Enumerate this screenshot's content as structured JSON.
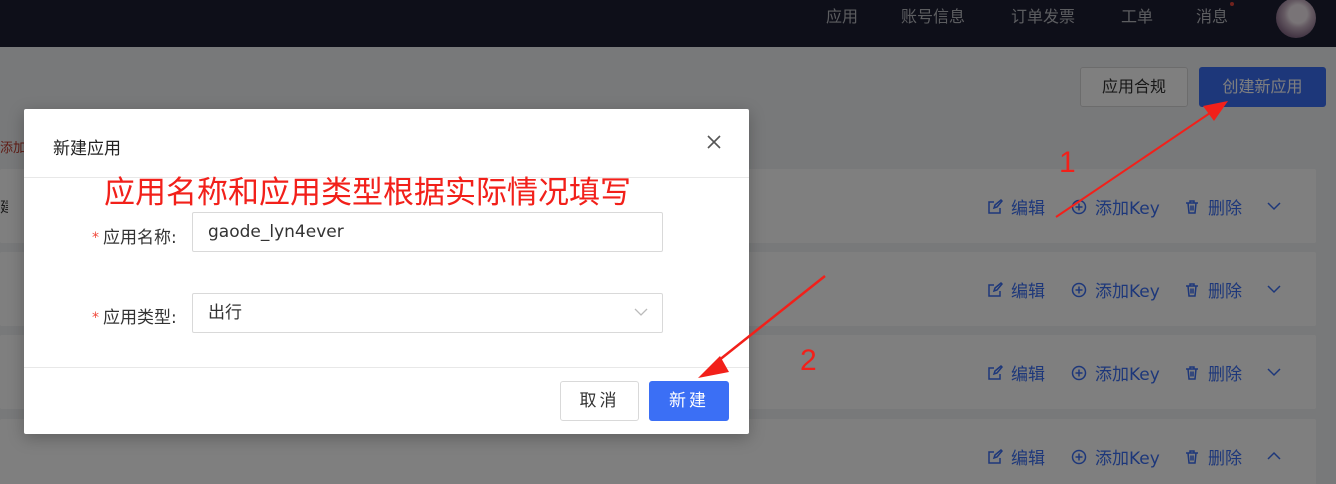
{
  "nav": {
    "items": [
      "应用",
      "账号信息",
      "订单发票",
      "工单",
      "消息"
    ],
    "notification_color": "#e0443a"
  },
  "toolbar": {
    "compliance_label": "应用合规",
    "create_label": "创建新应用"
  },
  "side_text": "添加新",
  "rows": [
    {
      "text": "建",
      "actions": [
        "编辑",
        "添加Key",
        "删除"
      ],
      "expanded": false
    },
    {
      "text": "",
      "actions": [
        "编辑",
        "添加Key",
        "删除"
      ],
      "expanded": false
    },
    {
      "text": "",
      "actions": [
        "编辑",
        "添加Key",
        "删除"
      ],
      "expanded": false
    },
    {
      "text": "",
      "actions": [
        "编辑",
        "添加Key",
        "删除"
      ],
      "expanded": true
    }
  ],
  "modal": {
    "title": "新建应用",
    "annotation": "应用名称和应用类型根据实际情况填写",
    "name_label": "应用名称:",
    "name_value": "gaode_lyn4ever",
    "type_label": "应用类型:",
    "type_value": "出行",
    "required_mark": "*",
    "cancel_label": "取消",
    "create_label": "新建"
  },
  "annotations": {
    "step1": "1",
    "step2": "2",
    "color": "#f2201a"
  },
  "colors": {
    "primary": "#3b6ff5",
    "nav_bg": "#1c1f33"
  }
}
